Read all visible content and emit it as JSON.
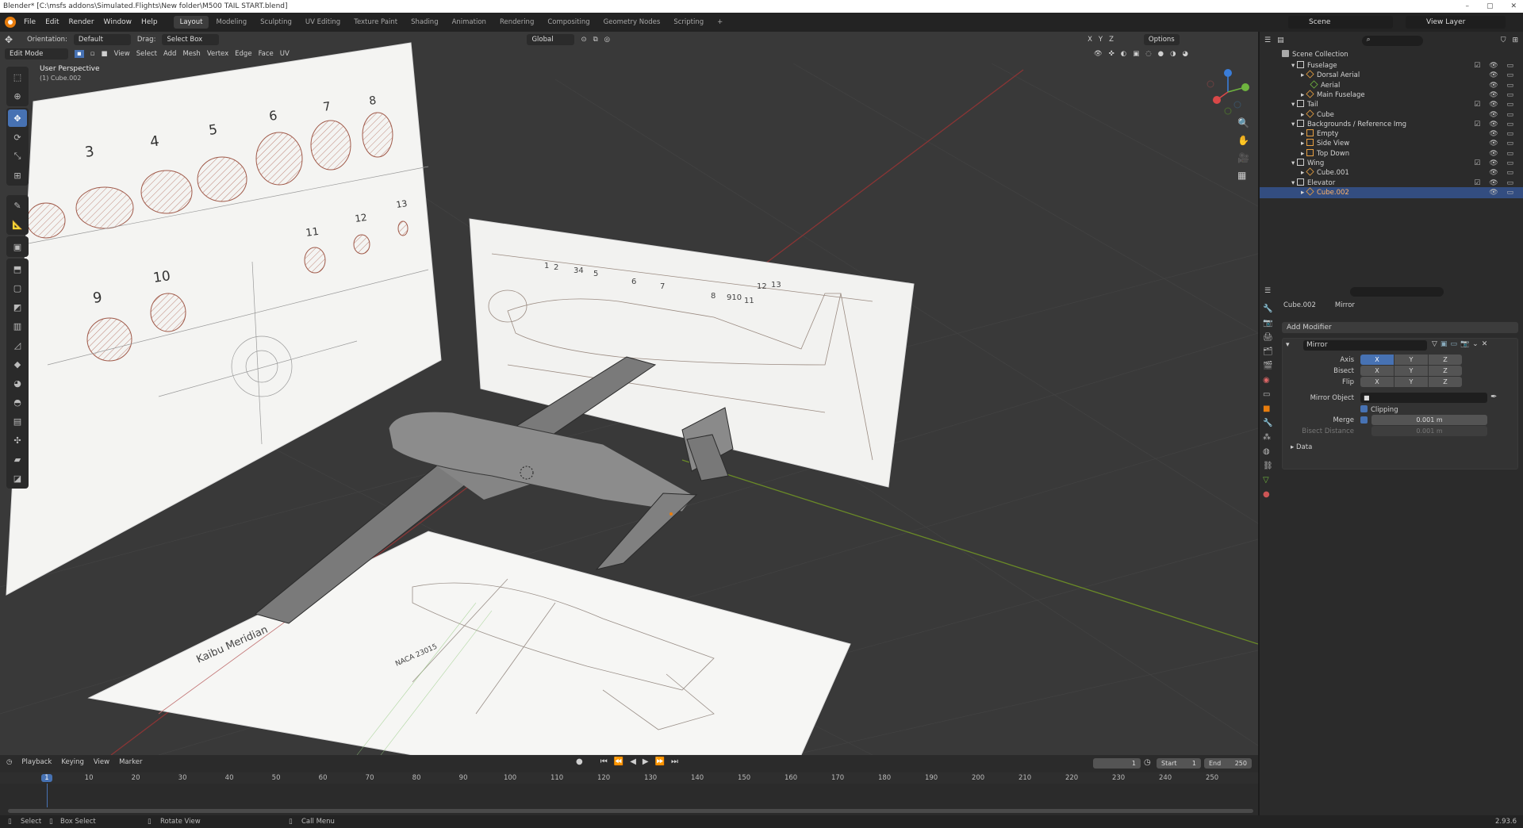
{
  "window": {
    "title": "Blender* [C:\\msfs addons\\Simulated.Flights\\New folder\\M500 TAIL START.blend]"
  },
  "menus": [
    "File",
    "Edit",
    "Render",
    "Window",
    "Help"
  ],
  "workspaces": [
    "Layout",
    "Modeling",
    "Sculpting",
    "UV Editing",
    "Texture Paint",
    "Shading",
    "Animation",
    "Rendering",
    "Compositing",
    "Geometry Nodes",
    "Scripting"
  ],
  "active_workspace": "Layout",
  "scene": {
    "name": "Scene",
    "view_layer": "View Layer"
  },
  "viewport_header": {
    "orientation_label": "Orientation:",
    "orientation_value": "Default",
    "drag_label": "Drag:",
    "drag_value": "Select Box",
    "transform_orientation": "Global",
    "options": "Options",
    "mode": "Edit Mode",
    "menu": [
      "View",
      "Select",
      "Add",
      "Mesh",
      "Vertex",
      "Edge",
      "Face",
      "UV"
    ],
    "axes": [
      "X",
      "Y",
      "Z"
    ]
  },
  "viewport": {
    "perspective_label": "User Perspective",
    "sub_label": "(1) Cube.002"
  },
  "blueprint_numbers": {
    "left": [
      "3",
      "4",
      "5",
      "6",
      "7",
      "8",
      "9",
      "10",
      "11",
      "12",
      "13"
    ],
    "middle": [
      "1",
      "2",
      "34",
      "5",
      "6",
      "7",
      "8",
      "910",
      "11",
      "12",
      "13"
    ],
    "bottom_title": "Kaibu Meridian",
    "bottom_note": "NACA 23015"
  },
  "outliner": {
    "root": "Scene Collection",
    "rows": [
      {
        "label": "Fuselage",
        "depth": 1,
        "type": "collection"
      },
      {
        "label": "Dorsal Aerial",
        "depth": 2,
        "type": "object"
      },
      {
        "label": "Aerial",
        "depth": 3,
        "type": "mesh"
      },
      {
        "label": "Main Fuselage",
        "depth": 2,
        "type": "object"
      },
      {
        "label": "Tail",
        "depth": 1,
        "type": "collection"
      },
      {
        "label": "Cube",
        "depth": 2,
        "type": "object"
      },
      {
        "label": "Backgrounds / Reference Img",
        "depth": 1,
        "type": "collection"
      },
      {
        "label": "Empty",
        "depth": 2,
        "type": "empty"
      },
      {
        "label": "Side View",
        "depth": 2,
        "type": "empty"
      },
      {
        "label": "Top Down",
        "depth": 2,
        "type": "empty"
      },
      {
        "label": "Wing",
        "depth": 1,
        "type": "collection"
      },
      {
        "label": "Cube.001",
        "depth": 2,
        "type": "object"
      },
      {
        "label": "Elevator",
        "depth": 1,
        "type": "collection"
      },
      {
        "label": "Cube.002",
        "depth": 2,
        "type": "object",
        "selected": true
      }
    ]
  },
  "properties": {
    "object_name": "Cube.002",
    "modifier_tab": "Mirror",
    "add_modifier": "Add Modifier",
    "modifier_name": "Mirror",
    "axis_label": "Axis",
    "bisect_label": "Bisect",
    "flip_label": "Flip",
    "xyz": [
      "X",
      "Y",
      "Z"
    ],
    "mirror_object_label": "Mirror Object",
    "clipping_label": "Clipping",
    "merge_label": "Merge",
    "merge_value": "0.001 m",
    "bisect_distance_label": "Bisect Distance",
    "bisect_distance_value": "0.001 m",
    "data_label": "Data"
  },
  "timeline": {
    "menu": [
      "Playback",
      "Keying",
      "View",
      "Marker"
    ],
    "current_frame": "1",
    "start_label": "Start",
    "start": "1",
    "end_label": "End",
    "end": "250",
    "ticks": [
      "1",
      "10",
      "20",
      "30",
      "40",
      "50",
      "60",
      "70",
      "80",
      "90",
      "100",
      "110",
      "120",
      "130",
      "140",
      "150",
      "160",
      "170",
      "180",
      "190",
      "200",
      "210",
      "220",
      "230",
      "240",
      "250"
    ]
  },
  "statusbar": {
    "select": "Select",
    "box_select": "Box Select",
    "rotate_view": "Rotate View",
    "call_menu": "Call Menu",
    "version": "2.93.6"
  },
  "colors": {
    "accent": "#4772b3",
    "selected_row": "#334d80",
    "orange": "#e87d0d",
    "green": "#6fb43f",
    "axis_red": "#8a3535",
    "axis_green": "#6a8a27"
  }
}
